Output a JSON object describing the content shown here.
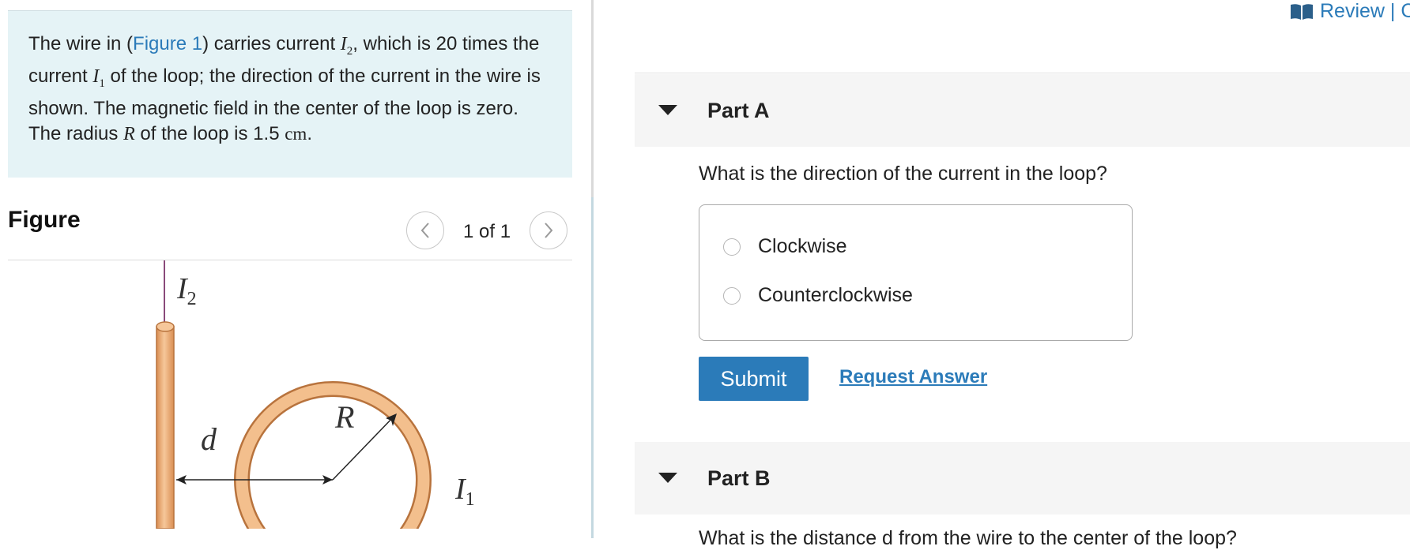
{
  "problem": {
    "text_before_link": "The wire in (",
    "figure_link": "Figure 1",
    "text_part2": ") carries current ",
    "var_I2": "I",
    "var_I2_sub": "2",
    "text_part3": ", which is 20 times the current ",
    "var_I1": "I",
    "var_I1_sub": "1",
    "text_part4": " of the loop; the direction of the current in the wire is shown. The magnetic field in the center of the loop is zero. The radius ",
    "var_R": "R",
    "text_part5": " of the loop is ",
    "value": "1.5",
    "unit": "cm",
    "end": "."
  },
  "figure": {
    "heading": "Figure",
    "page_indicator": "1 of 1",
    "label_I2": "I",
    "label_I2_sub": "2",
    "label_d": "d",
    "label_R": "R",
    "label_I1": "I",
    "label_I1_sub": "1"
  },
  "header": {
    "review_label": "Review | C"
  },
  "part_a": {
    "title": "Part A",
    "question": "What is the direction of the current in the loop?",
    "options": [
      "Clockwise",
      "Counterclockwise"
    ],
    "submit_label": "Submit",
    "request_answer_label": "Request Answer"
  },
  "part_b": {
    "title": "Part B",
    "question_partial": "What is the distance d from the wire to the center of the loop?"
  },
  "icons": {
    "caret": "caret-down-icon",
    "prev": "chevron-left-icon",
    "next": "chevron-right-icon",
    "review": "book-icon"
  },
  "colors": {
    "accent": "#2b7bb9",
    "intro_bg": "#e5f3f6",
    "wire_fill": "#f0b07a",
    "loop_outline": "#c9874e"
  }
}
